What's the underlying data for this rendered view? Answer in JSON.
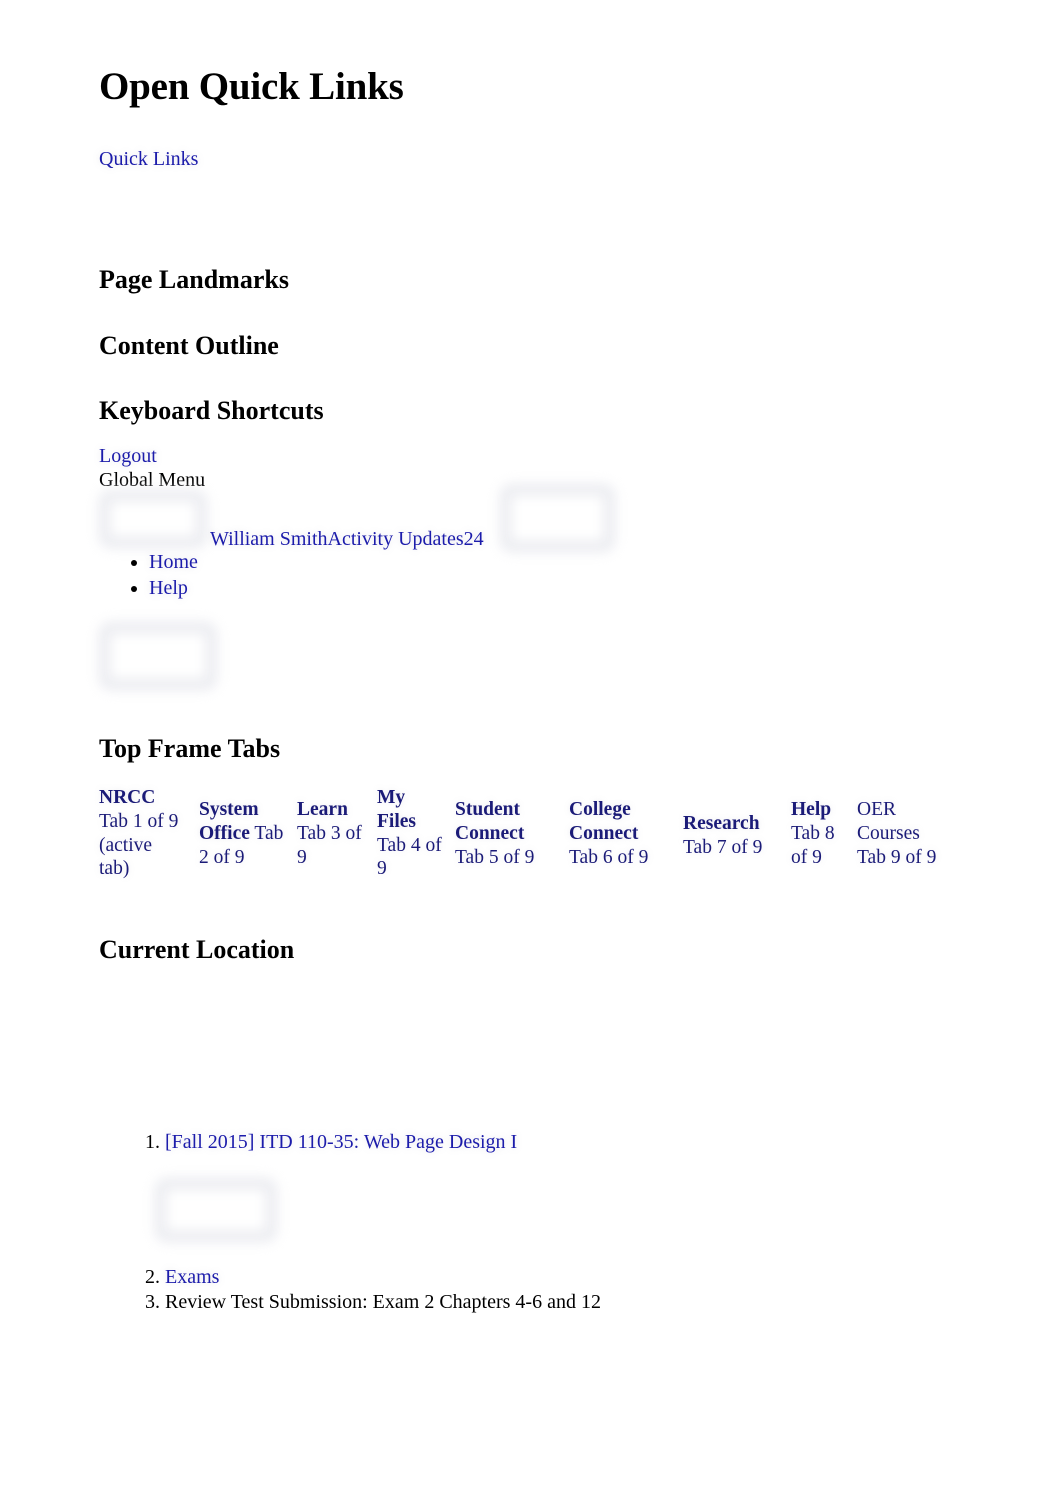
{
  "page": {
    "title": "Open Quick Links",
    "quick_links_label": "Quick Links"
  },
  "sections": {
    "page_landmarks": "Page Landmarks",
    "content_outline": "Content Outline",
    "keyboard_shortcuts": "Keyboard Shortcuts",
    "top_frame_tabs": "Top Frame Tabs",
    "current_location": "Current Location"
  },
  "shortcuts": {
    "logout_label": "Logout",
    "global_menu_label": "Global Menu"
  },
  "global_menu": {
    "user_activity_label": "William SmithActivity Updates24",
    "user_name": "William Smith",
    "activity_updates_label": "Activity Updates",
    "activity_updates_count": "24",
    "items": [
      {
        "label": "Home"
      },
      {
        "label": "Help"
      }
    ]
  },
  "top_frame_tabs": {
    "tabs": [
      {
        "name": "NRCC",
        "position": " Tab 1 of 9 (active tab)",
        "bold": true,
        "active": true
      },
      {
        "name": "System Office",
        "position": " Tab 2 of 9",
        "bold": true,
        "active": false
      },
      {
        "name": "Learn",
        "position": " Tab 3 of 9",
        "bold": true,
        "active": false
      },
      {
        "name": "My Files",
        "position": " Tab 4 of 9",
        "bold": true,
        "active": false
      },
      {
        "name": "Student Connect",
        "position": " Tab 5 of 9",
        "bold": true,
        "active": false
      },
      {
        "name": "College Connect",
        "position": " Tab 6 of 9",
        "bold": true,
        "active": false
      },
      {
        "name": "Research",
        "position": " Tab 7 of 9",
        "bold": true,
        "active": false
      },
      {
        "name": "Help",
        "position": " Tab 8 of 9",
        "bold": true,
        "active": false
      },
      {
        "name": "OER Courses",
        "position": " Tab 9 of 9",
        "bold": false,
        "active": false
      }
    ]
  },
  "current_location": {
    "breadcrumb": [
      {
        "label": "[Fall 2015] ITD 110-35: Web Page Design I",
        "is_link": true
      },
      {
        "label": "Exams",
        "is_link": true
      },
      {
        "label": "Review Test Submission: Exam 2 Chapters 4-6 and 12",
        "is_link": false
      }
    ]
  },
  "icons": {
    "user_avatar": "user-avatar-image",
    "updates_badge": "activity-updates-badge-image",
    "global_menu": "global-menu-image",
    "course_icon": "course-icon-image"
  },
  "colors": {
    "link": "#1c1cab",
    "tab_text": "#1b1b78",
    "text": "#000000",
    "background": "#ffffff",
    "ghost_border": "#e9eaef"
  }
}
